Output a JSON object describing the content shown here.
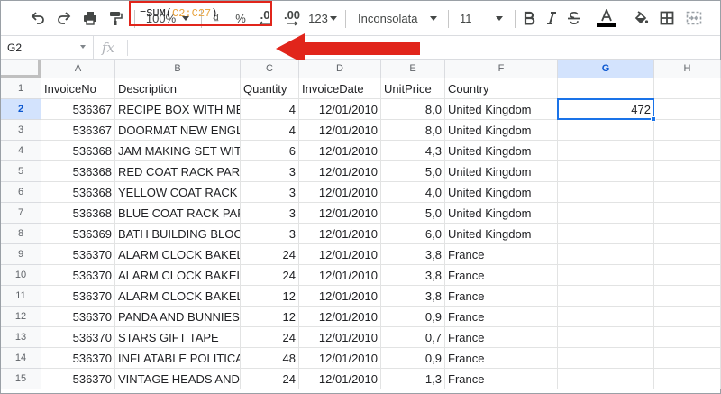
{
  "toolbar": {
    "zoom": "100%",
    "currency_label": "₫",
    "percent_label": "%",
    "decrease_decimals_label": ".0",
    "increase_decimals_label": ".00",
    "more_formats_label": "123",
    "font_family": "Inconsolata",
    "font_size": "11"
  },
  "formula_bar": {
    "cell_ref": "G2",
    "fx_label": "fx",
    "formula_prefix": "=SUM(",
    "formula_range": "C2:C27",
    "formula_suffix": ")"
  },
  "annotation": {
    "arrow_color": "#e1251b",
    "box_color": "#e1251b"
  },
  "columns": [
    "A",
    "B",
    "C",
    "D",
    "E",
    "F",
    "G",
    "H"
  ],
  "rows": [
    {
      "n": "1",
      "cells": [
        "InvoiceNo",
        "Description",
        "Quantity",
        "InvoiceDate",
        "UnitPrice",
        "Country",
        "",
        ""
      ]
    },
    {
      "n": "2",
      "cells": [
        "536367",
        "RECIPE BOX WITH MET",
        "4",
        "12/01/2010",
        "8,0",
        "United Kingdom",
        "472",
        ""
      ]
    },
    {
      "n": "3",
      "cells": [
        "536367",
        "DOORMAT NEW ENGLA",
        "4",
        "12/01/2010",
        "8,0",
        "United Kingdom",
        "",
        ""
      ]
    },
    {
      "n": "4",
      "cells": [
        "536368",
        "JAM MAKING SET WITH",
        "6",
        "12/01/2010",
        "4,3",
        "United Kingdom",
        "",
        ""
      ]
    },
    {
      "n": "5",
      "cells": [
        "536368",
        "RED COAT RACK PARIS",
        "3",
        "12/01/2010",
        "5,0",
        "United Kingdom",
        "",
        ""
      ]
    },
    {
      "n": "6",
      "cells": [
        "536368",
        "YELLOW COAT RACK PA",
        "3",
        "12/01/2010",
        "4,0",
        "United Kingdom",
        "",
        ""
      ]
    },
    {
      "n": "7",
      "cells": [
        "536368",
        "BLUE COAT RACK PARIS",
        "3",
        "12/01/2010",
        "5,0",
        "United Kingdom",
        "",
        ""
      ]
    },
    {
      "n": "8",
      "cells": [
        "536369",
        "BATH BUILDING BLOCK",
        "3",
        "12/01/2010",
        "6,0",
        "United Kingdom",
        "",
        ""
      ]
    },
    {
      "n": "9",
      "cells": [
        "536370",
        "ALARM CLOCK BAKELIK",
        "24",
        "12/01/2010",
        "3,8",
        "France",
        "",
        ""
      ]
    },
    {
      "n": "10",
      "cells": [
        "536370",
        "ALARM CLOCK BAKELIK",
        "24",
        "12/01/2010",
        "3,8",
        "France",
        "",
        ""
      ]
    },
    {
      "n": "11",
      "cells": [
        "536370",
        "ALARM CLOCK BAKELIK",
        "12",
        "12/01/2010",
        "3,8",
        "France",
        "",
        ""
      ]
    },
    {
      "n": "12",
      "cells": [
        "536370",
        "PANDA AND BUNNIES S",
        "12",
        "12/01/2010",
        "0,9",
        "France",
        "",
        ""
      ]
    },
    {
      "n": "13",
      "cells": [
        "536370",
        "STARS GIFT TAPE",
        "24",
        "12/01/2010",
        "0,7",
        "France",
        "",
        ""
      ]
    },
    {
      "n": "14",
      "cells": [
        "536370",
        "INFLATABLE POLITICAL",
        "48",
        "12/01/2010",
        "0,9",
        "France",
        "",
        ""
      ]
    },
    {
      "n": "15",
      "cells": [
        "536370",
        "VINTAGE HEADS AND T",
        "24",
        "12/01/2010",
        "1,3",
        "France",
        "",
        ""
      ]
    }
  ],
  "selected_cell": {
    "column": "G",
    "row": "2"
  }
}
